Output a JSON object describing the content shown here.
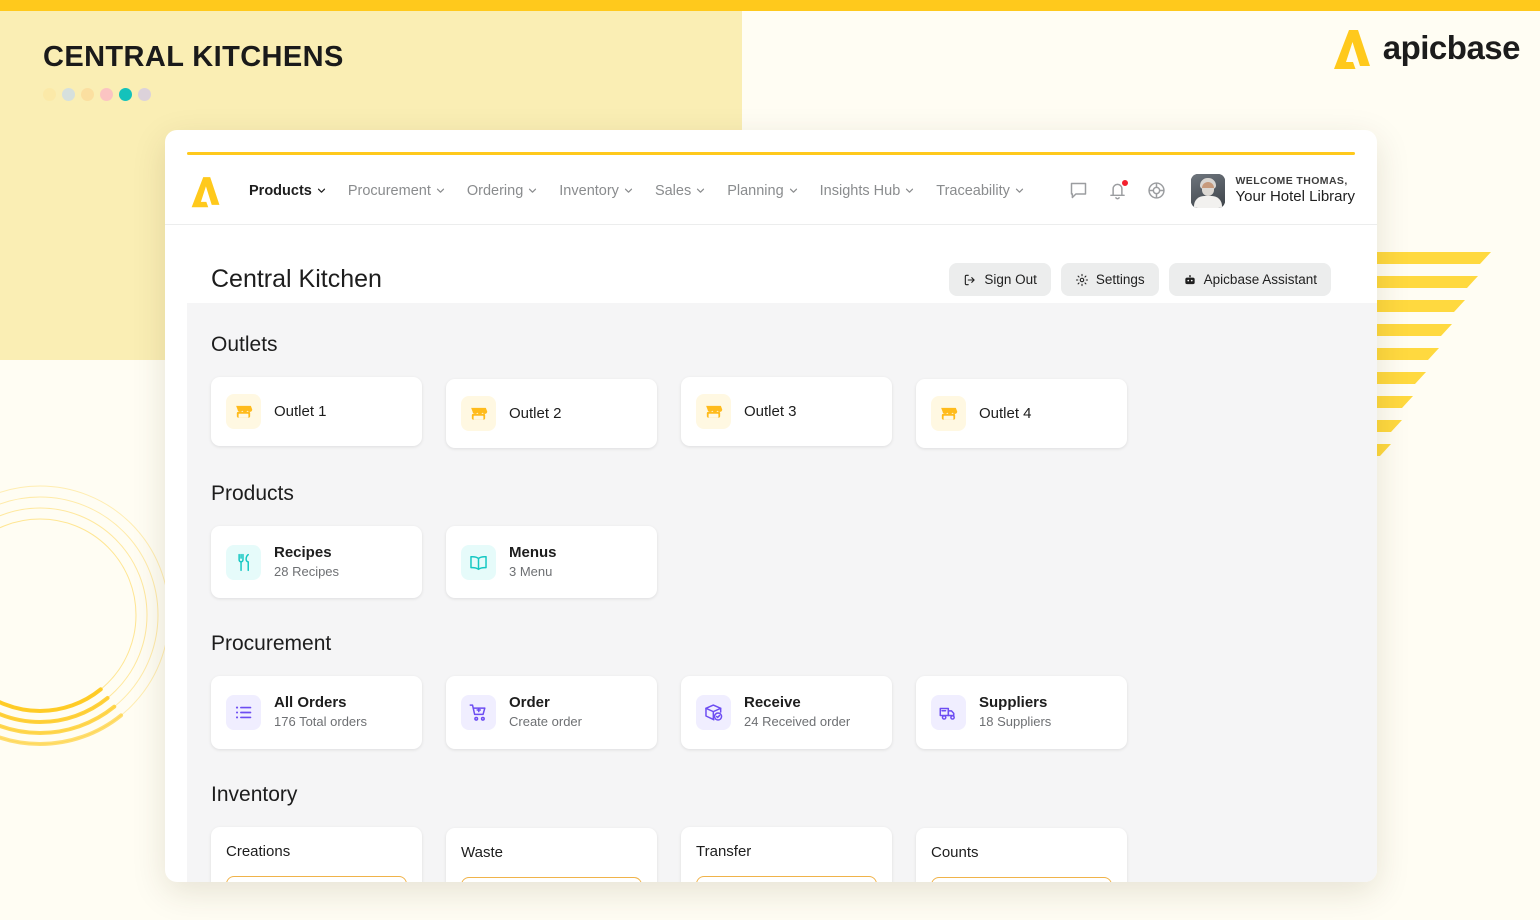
{
  "hero": {
    "title": "CENTRAL KITCHENS",
    "dots": [
      "#fbe9a8",
      "#d6e0dd",
      "#fbdfa0",
      "#fbc4c2",
      "#14c2bb",
      "#dcd2da"
    ]
  },
  "brand": {
    "name": "apicbase",
    "logo_icon": "apicbase-a-logo",
    "color": "#ffc91c"
  },
  "nav": {
    "logo_icon": "apicbase-a-logo",
    "items": [
      {
        "label": "Products",
        "active": true,
        "caret": "chevron-down-icon"
      },
      {
        "label": "Procurement",
        "active": false,
        "caret": "chevron-down-icon"
      },
      {
        "label": "Ordering",
        "active": false,
        "caret": "chevron-down-icon"
      },
      {
        "label": "Inventory",
        "active": false,
        "caret": "chevron-down-icon"
      },
      {
        "label": "Sales",
        "active": false,
        "caret": "chevron-down-icon"
      },
      {
        "label": "Planning",
        "active": false,
        "caret": "chevron-down-icon"
      },
      {
        "label": "Insights Hub",
        "active": false,
        "caret": "chevron-down-icon"
      },
      {
        "label": "Traceability",
        "active": false,
        "caret": "chevron-down-icon"
      }
    ],
    "icons": [
      "chat-bubble-icon",
      "bell-icon",
      "help-lifebuoy-icon"
    ],
    "notification_badge_color": "#f4212e",
    "user": {
      "greeting": "WELCOME THOMAS,",
      "library": "Your Hotel Library",
      "avatar": "user-avatar-photo"
    }
  },
  "page": {
    "title": "Central Kitchen",
    "actions": [
      {
        "label": "Sign Out",
        "icon": "sign-out-icon"
      },
      {
        "label": "Settings",
        "icon": "gear-icon"
      },
      {
        "label": "Apicbase Assistant",
        "icon": "assistant-robot-icon"
      }
    ]
  },
  "sections": {
    "outlets": {
      "title": "Outlets",
      "cards": [
        {
          "label": "Outlet 1",
          "icon": "storefront-icon"
        },
        {
          "label": "Outlet 2",
          "icon": "storefront-icon"
        },
        {
          "label": "Outlet 3",
          "icon": "storefront-icon"
        },
        {
          "label": "Outlet 4",
          "icon": "storefront-icon"
        }
      ]
    },
    "products": {
      "title": "Products",
      "cards": [
        {
          "title": "Recipes",
          "sub": "28 Recipes",
          "icon": "fork-knife-icon"
        },
        {
          "title": "Menus",
          "sub": "3 Menu",
          "icon": "open-book-icon"
        }
      ]
    },
    "procurement": {
      "title": "Procurement",
      "cards": [
        {
          "title": "All Orders",
          "sub": "176 Total orders",
          "icon": "list-icon"
        },
        {
          "title": "Order",
          "sub": "Create order",
          "icon": "cart-plus-icon"
        },
        {
          "title": "Receive",
          "sub": "24 Received order",
          "icon": "box-check-icon"
        },
        {
          "title": "Suppliers",
          "sub": "18 Suppliers",
          "icon": "delivery-truck-icon"
        }
      ]
    },
    "inventory": {
      "title": "Inventory",
      "cards": [
        {
          "title": "Creations"
        },
        {
          "title": "Waste"
        },
        {
          "title": "Transfer"
        },
        {
          "title": "Counts"
        }
      ]
    }
  }
}
